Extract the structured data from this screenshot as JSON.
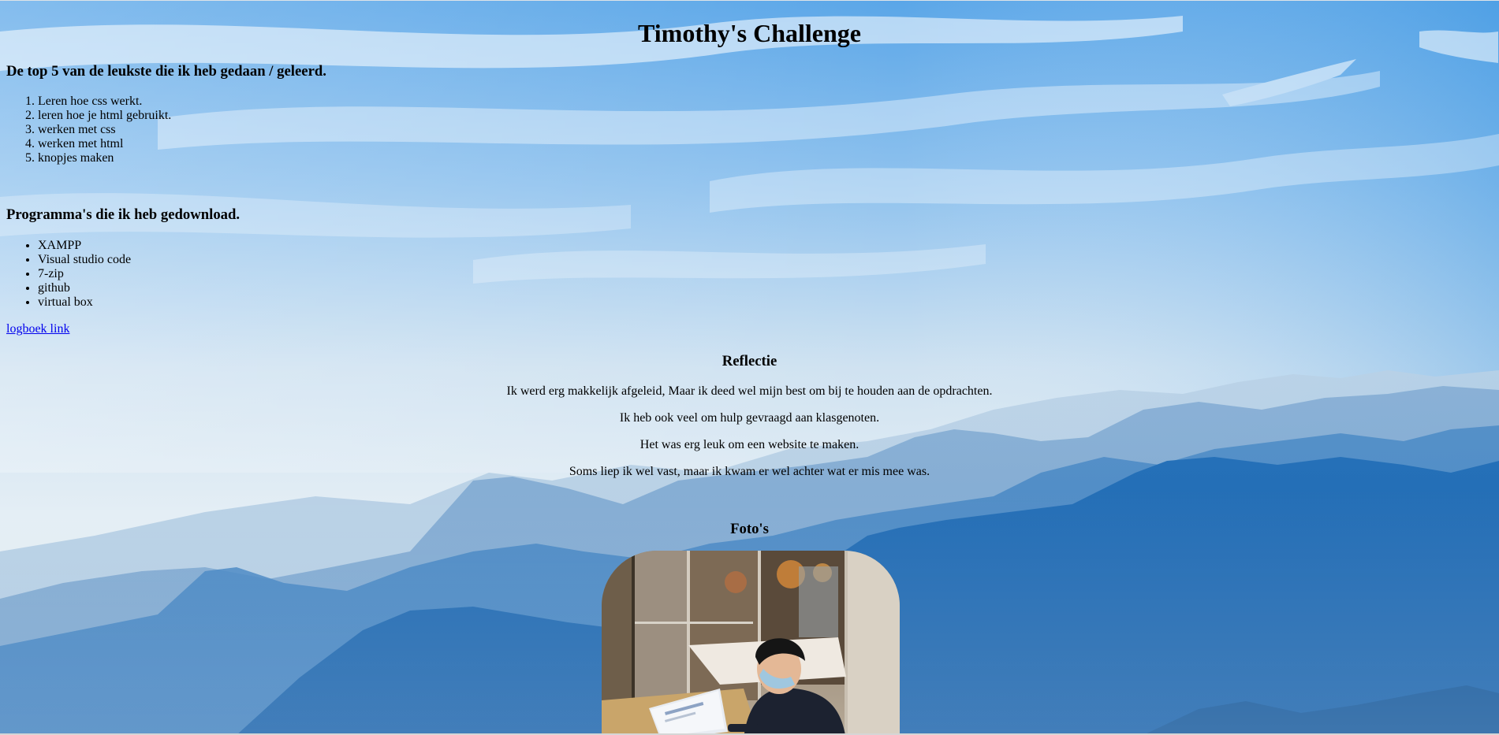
{
  "page": {
    "title": "Timothy's Challenge"
  },
  "top5": {
    "heading": "De top 5 van de leukste die ik heb gedaan / geleerd.",
    "items": [
      "Leren hoe css werkt.",
      "leren hoe je html gebruikt.",
      "werken met css",
      "werken met html",
      "knopjes maken"
    ]
  },
  "programs": {
    "heading": "Programma's die ik heb gedownload.",
    "items": [
      "XAMPP",
      "Visual studio code",
      "7-zip",
      "github",
      "virtual box"
    ]
  },
  "logbook": {
    "link_text": "logboek link"
  },
  "reflection": {
    "heading": "Reflectie",
    "paragraphs": [
      "Ik werd erg makkelijk afgeleid, Maar ik deed wel mijn best om bij te houden aan de opdrachten.",
      "Ik heb ook veel om hulp gevraagd aan klasgenoten.",
      "Het was erg leuk om een website te maken.",
      "Soms liep ik wel vast, maar ik kwam er wel achter wat er mis mee was."
    ]
  },
  "photos": {
    "heading": "Foto's"
  },
  "colors": {
    "link": "#0000ee",
    "sky_top": "#5ea8e6",
    "mountain_dark": "#1f6fb4"
  }
}
